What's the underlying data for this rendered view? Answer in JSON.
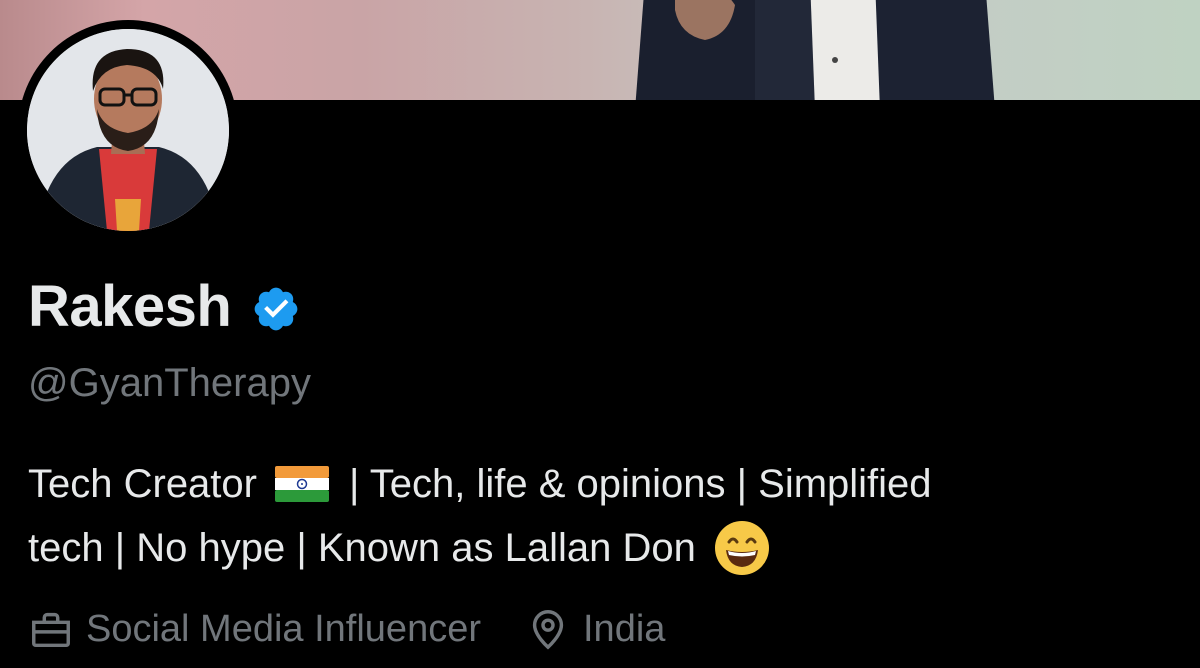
{
  "profile": {
    "display_name": "Rakesh",
    "handle": "@GyanTherapy",
    "bio": {
      "line1_part1": "Tech Creator",
      "line1_part2": "| Tech, life & opinions | Simplified",
      "line2": "tech | No hype | Known as Lallan Don"
    },
    "meta": {
      "profession": "Social Media Influencer",
      "location": "India"
    },
    "icons": {
      "verified": "verified-badge-icon",
      "flag": "india-flag-emoji",
      "emoji": "grinning-face-emoji",
      "profession": "briefcase-icon",
      "location": "location-pin-icon"
    },
    "colors": {
      "background": "#000000",
      "name": "#e7e9ea",
      "secondary": "#71767b",
      "verified": "#1d9bf0"
    }
  }
}
